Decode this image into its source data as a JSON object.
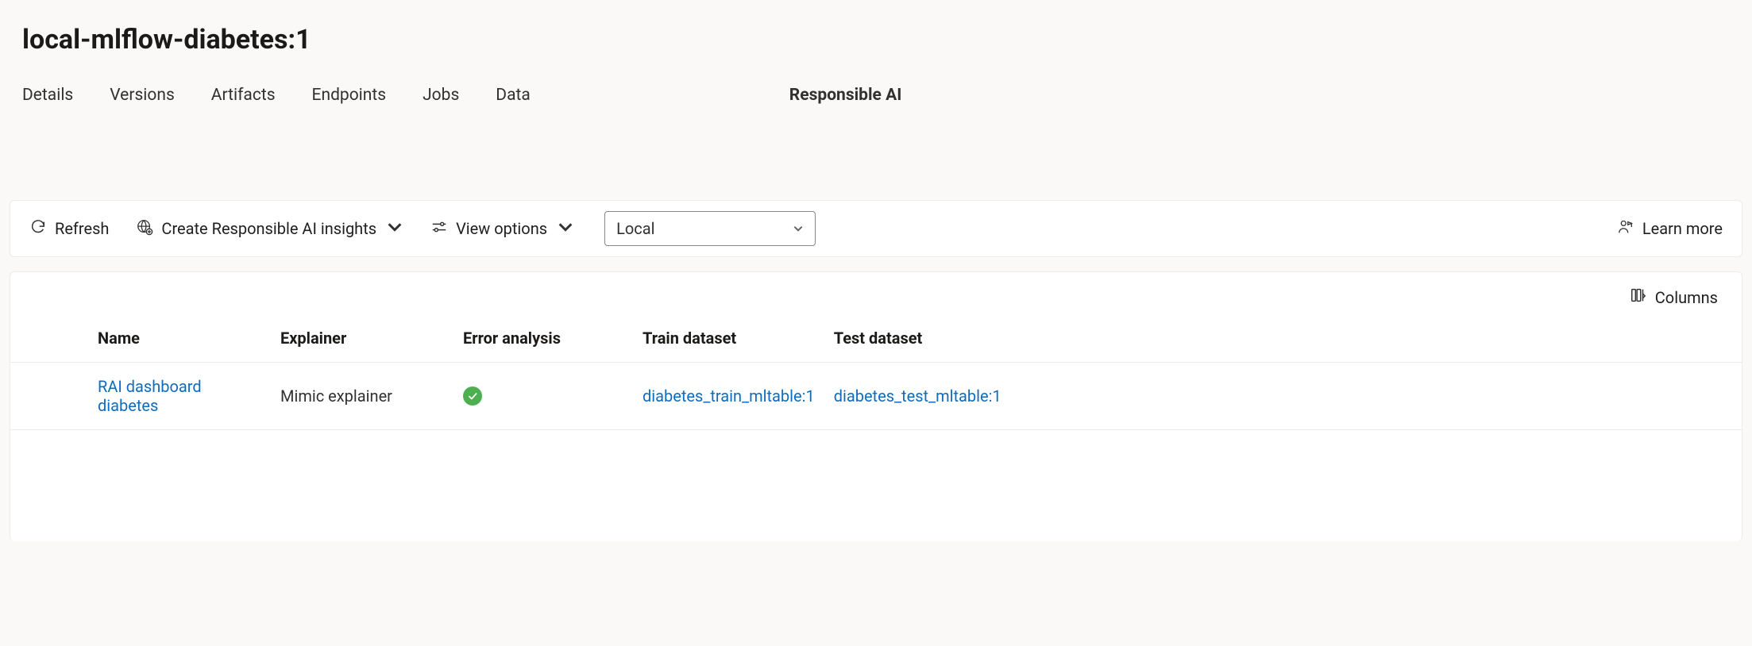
{
  "title": "local-mlflow-diabetes:1",
  "tabs": {
    "details": "Details",
    "versions": "Versions",
    "artifacts": "Artifacts",
    "endpoints": "Endpoints",
    "jobs": "Jobs",
    "data": "Data",
    "responsible_ai": "Responsible AI"
  },
  "toolbar": {
    "refresh": "Refresh",
    "create_rai": "Create Responsible AI insights",
    "view_options": "View options",
    "dropdown_value": "Local",
    "learn_more": "Learn more"
  },
  "card": {
    "columns_btn": "Columns"
  },
  "table": {
    "headers": {
      "name": "Name",
      "explainer": "Explainer",
      "error_analysis": "Error analysis",
      "train_dataset": "Train dataset",
      "test_dataset": "Test dataset"
    },
    "rows": [
      {
        "name": "RAI dashboard diabetes",
        "explainer": "Mimic explainer",
        "error_analysis_status": "success",
        "train_dataset": "diabetes_train_mltable:1",
        "test_dataset": "diabetes_test_mltable:1"
      }
    ]
  }
}
